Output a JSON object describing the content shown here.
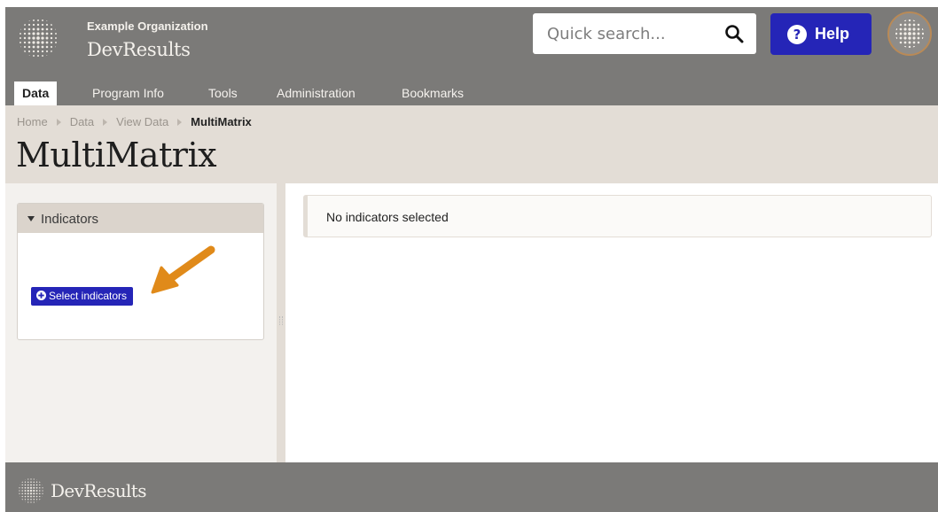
{
  "header": {
    "org_name": "Example Organization",
    "app_name": "DevResults",
    "search": {
      "placeholder": "Quick search..."
    },
    "help_label": "Help"
  },
  "nav": {
    "items": [
      {
        "label": "Data",
        "active": true
      },
      {
        "label": "Program Info",
        "active": false
      },
      {
        "label": "Tools",
        "active": false
      },
      {
        "label": "Administration",
        "active": false
      },
      {
        "label": "Bookmarks",
        "active": false
      }
    ]
  },
  "breadcrumb": {
    "items": [
      "Home",
      "Data",
      "View Data"
    ],
    "current": "MultiMatrix"
  },
  "page": {
    "title": "MultiMatrix"
  },
  "sidebar": {
    "panel_title": "Indicators",
    "select_button": "Select indicators"
  },
  "main": {
    "empty_message": "No indicators selected"
  },
  "footer": {
    "brand": "DevResults"
  },
  "colors": {
    "header_bg": "#7b7a78",
    "band_bg": "#e3ddd6",
    "accent": "#2525b7",
    "annotation_arrow": "#e08a1a"
  },
  "icons": [
    "globe-logo-icon",
    "search-icon",
    "question-circle-icon",
    "caret-down-icon",
    "plus-circle-icon",
    "arrow-annotation"
  ]
}
